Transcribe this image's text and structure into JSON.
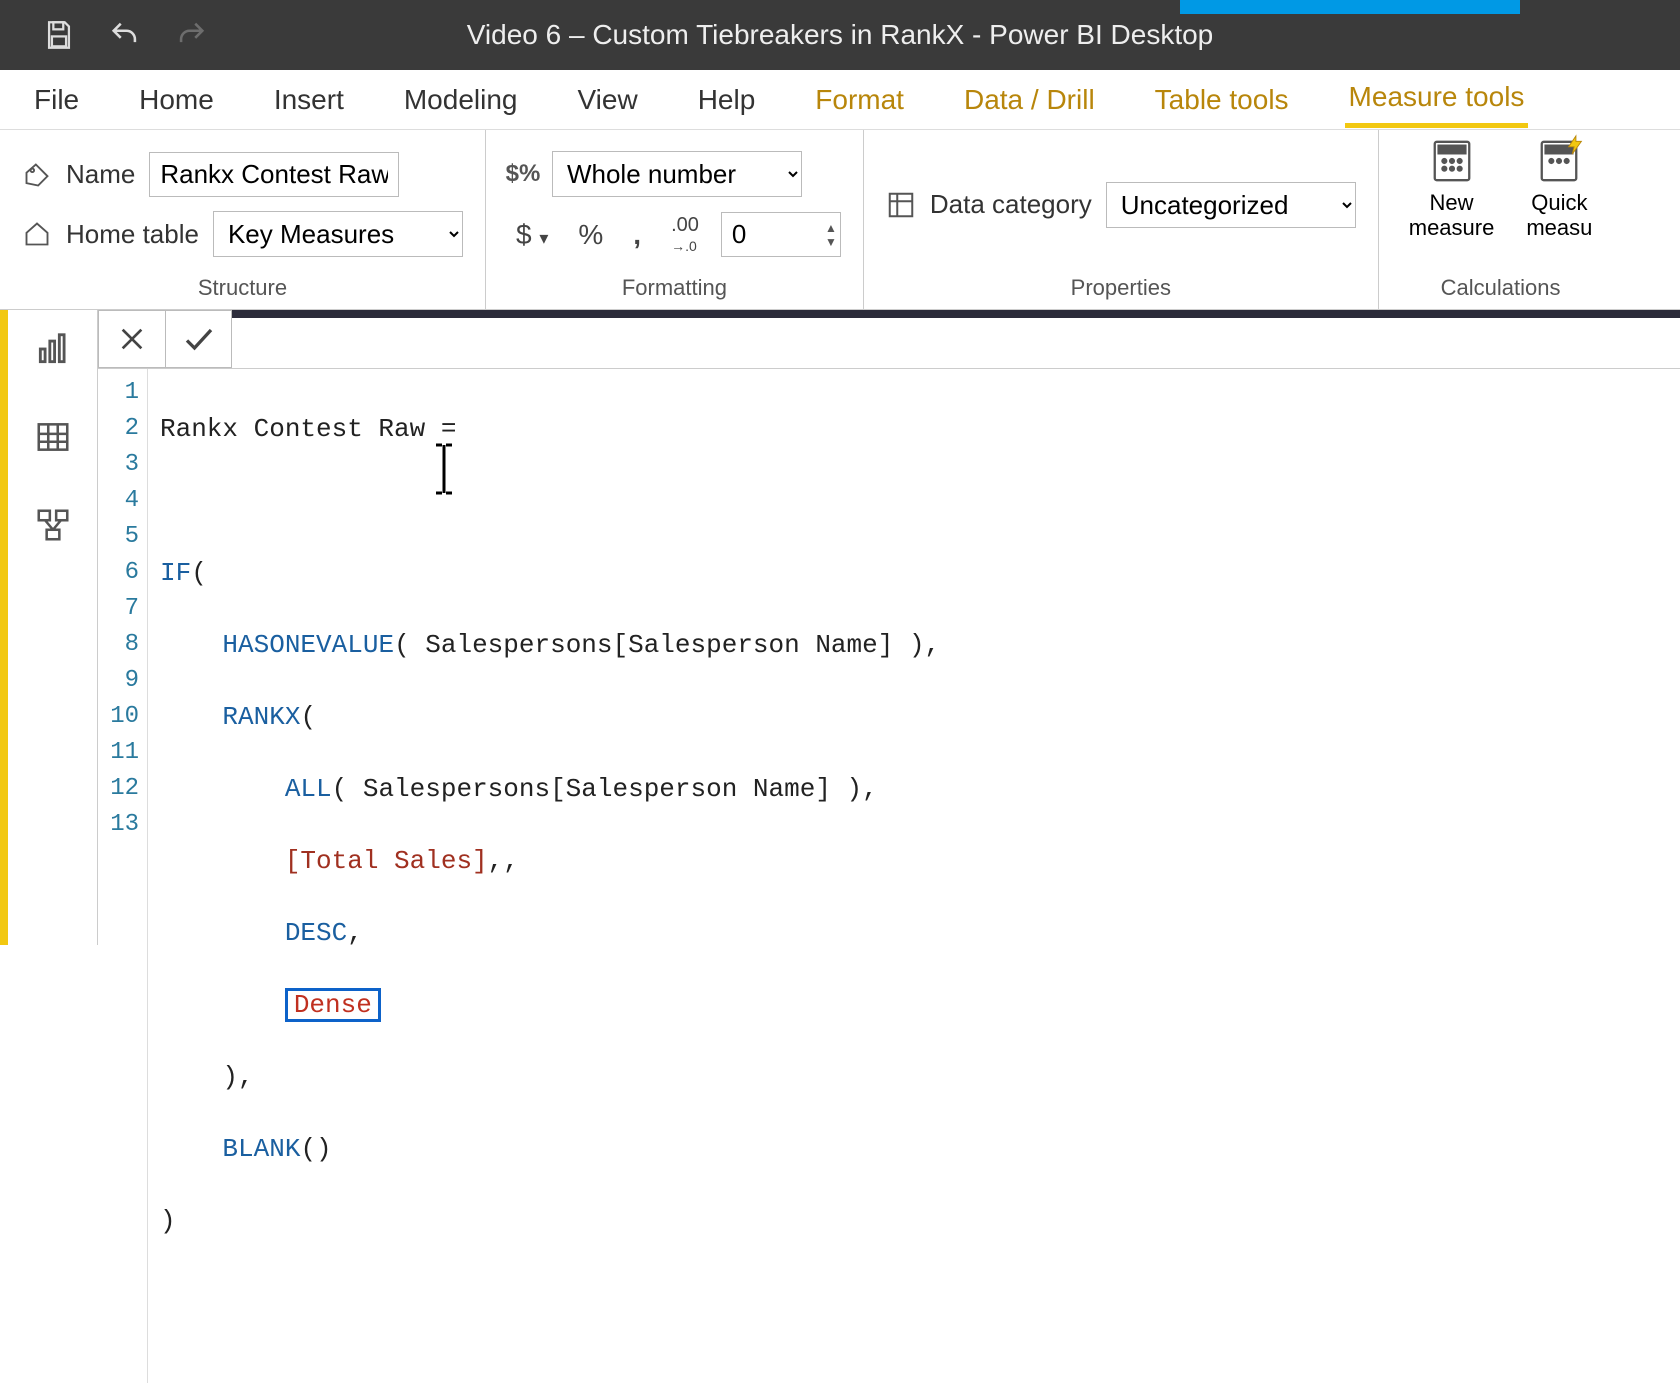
{
  "titleBar": {
    "appTitle": "Video 6 – Custom Tiebreakers in RankX - Power BI Desktop"
  },
  "ribbonTabs": {
    "file": "File",
    "home": "Home",
    "insert": "Insert",
    "modeling": "Modeling",
    "view": "View",
    "help": "Help",
    "format": "Format",
    "dataDrill": "Data / Drill",
    "tableTools": "Table tools",
    "measureTools": "Measure tools"
  },
  "structure": {
    "nameLabel": "Name",
    "nameValue": "Rankx Contest Raw",
    "homeTableLabel": "Home table",
    "homeTableValue": "Key Measures",
    "groupLabel": "Structure"
  },
  "formatting": {
    "formatValue": "Whole number",
    "decimals": "0",
    "groupLabel": "Formatting"
  },
  "properties": {
    "dataCategoryLabel": "Data category",
    "dataCategoryValue": "Uncategorized",
    "groupLabel": "Properties"
  },
  "calculations": {
    "newMeasure": "New\nmeasure",
    "quickMeasure": "Quick\nmeasu",
    "groupLabel": "Calculations"
  },
  "editor": {
    "gutter": [
      "1",
      "2",
      "3",
      "4",
      "5",
      "6",
      "7",
      "8",
      "9",
      "10",
      "11",
      "12",
      "13"
    ],
    "line1": "Rankx Contest Raw =",
    "line3_if": "IF",
    "line3_rest": "(",
    "line4_func": "HASONEVALUE",
    "line4_rest": "( Salespersons[Salesperson Name] ),",
    "line5_func": "RANKX",
    "line5_rest": "(",
    "line6_func": "ALL",
    "line6_rest": "( Salespersons[Salesperson Name] ),",
    "line7_meas": "[Total Sales]",
    "line7_rest": ",,",
    "line8_kw": "DESC",
    "line8_rest": ",",
    "line9_dense": "Dense",
    "line10": "),",
    "line11_func": "BLANK",
    "line11_rest": "()",
    "line12": ")"
  }
}
